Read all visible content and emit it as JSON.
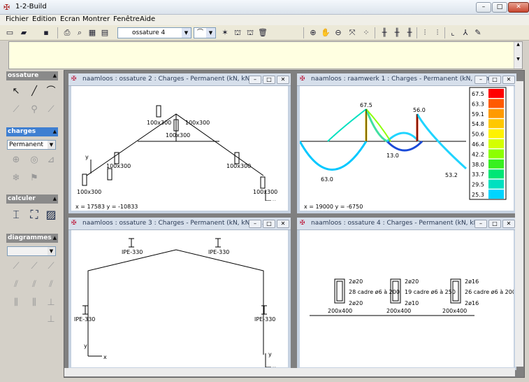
{
  "app": {
    "title": "1-2-Build"
  },
  "menu": [
    "Fichier",
    "Edition",
    "Ecran",
    "Montrer",
    "Fenêtre",
    "Aide"
  ],
  "toolbar": {
    "structure_combo": "ossature 4"
  },
  "left": {
    "ossature": "ossature",
    "charges": "charges",
    "charges_select": "Permanent",
    "calculer": "calculer",
    "diagrammes": "diagrammes"
  },
  "windows": [
    {
      "title": "naamloos : ossature 2 : Charges - Permanent (kN, kNm,...",
      "coord": "x = 17583 y = -10833",
      "sections": [
        "100x300",
        "100x300",
        "100x300",
        "100x300",
        "100x300",
        "100x300",
        "100x300"
      ]
    },
    {
      "title": "naamloos : raamwerk 1 : Charges - Permanent (kN, kNm,...",
      "coord": "x = 19000 y = -6750",
      "values": [
        "67.5",
        "56.0",
        "13.0",
        "63.0",
        "53.2"
      ],
      "legend": [
        "67.5",
        "63.3",
        "59.1",
        "54.8",
        "50.6",
        "46.4",
        "42.2",
        "38.0",
        "33.7",
        "29.5",
        "25.3"
      ],
      "legend_colors": [
        "#ff0000",
        "#ff5a00",
        "#ff9a00",
        "#ffc800",
        "#fff200",
        "#d4ff00",
        "#8cff00",
        "#38f020",
        "#00e676",
        "#00e0c0",
        "#00d4ff"
      ]
    },
    {
      "title": "naamloos : ossature 3 : Charges - Permanent (kN, kNm,...",
      "sections": [
        "IPE-330",
        "IPE-330",
        "IPE-330",
        "IPE-330"
      ]
    },
    {
      "title": "naamloos : ossature 4 : Charges - Permanent (kN, kN...",
      "beams": [
        {
          "top": "2ø20",
          "mid": "28 cadre ø6 à 200",
          "bot": "2ø20",
          "size": "200x400"
        },
        {
          "top": "2ø20",
          "mid": "19 cadre ø6 à 250",
          "bot": "2ø10",
          "size": "200x400"
        },
        {
          "top": "2ø16",
          "mid": "26 cadre ø6 à 200",
          "bot": "2ø16",
          "size": "200x400"
        }
      ]
    }
  ]
}
